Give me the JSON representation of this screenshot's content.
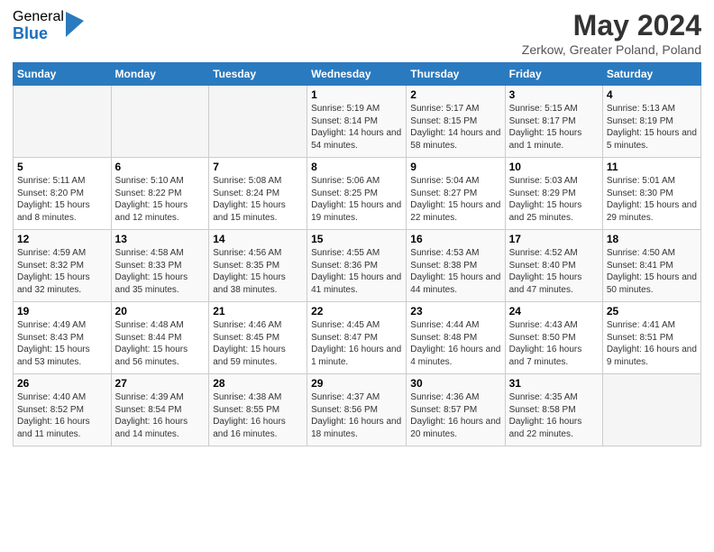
{
  "logo": {
    "general": "General",
    "blue": "Blue"
  },
  "title": "May 2024",
  "subtitle": "Zerkow, Greater Poland, Poland",
  "days_of_week": [
    "Sunday",
    "Monday",
    "Tuesday",
    "Wednesday",
    "Thursday",
    "Friday",
    "Saturday"
  ],
  "weeks": [
    [
      {
        "day": "",
        "info": ""
      },
      {
        "day": "",
        "info": ""
      },
      {
        "day": "",
        "info": ""
      },
      {
        "day": "1",
        "info": "Sunrise: 5:19 AM\nSunset: 8:14 PM\nDaylight: 14 hours and 54 minutes."
      },
      {
        "day": "2",
        "info": "Sunrise: 5:17 AM\nSunset: 8:15 PM\nDaylight: 14 hours and 58 minutes."
      },
      {
        "day": "3",
        "info": "Sunrise: 5:15 AM\nSunset: 8:17 PM\nDaylight: 15 hours and 1 minute."
      },
      {
        "day": "4",
        "info": "Sunrise: 5:13 AM\nSunset: 8:19 PM\nDaylight: 15 hours and 5 minutes."
      }
    ],
    [
      {
        "day": "5",
        "info": "Sunrise: 5:11 AM\nSunset: 8:20 PM\nDaylight: 15 hours and 8 minutes."
      },
      {
        "day": "6",
        "info": "Sunrise: 5:10 AM\nSunset: 8:22 PM\nDaylight: 15 hours and 12 minutes."
      },
      {
        "day": "7",
        "info": "Sunrise: 5:08 AM\nSunset: 8:24 PM\nDaylight: 15 hours and 15 minutes."
      },
      {
        "day": "8",
        "info": "Sunrise: 5:06 AM\nSunset: 8:25 PM\nDaylight: 15 hours and 19 minutes."
      },
      {
        "day": "9",
        "info": "Sunrise: 5:04 AM\nSunset: 8:27 PM\nDaylight: 15 hours and 22 minutes."
      },
      {
        "day": "10",
        "info": "Sunrise: 5:03 AM\nSunset: 8:29 PM\nDaylight: 15 hours and 25 minutes."
      },
      {
        "day": "11",
        "info": "Sunrise: 5:01 AM\nSunset: 8:30 PM\nDaylight: 15 hours and 29 minutes."
      }
    ],
    [
      {
        "day": "12",
        "info": "Sunrise: 4:59 AM\nSunset: 8:32 PM\nDaylight: 15 hours and 32 minutes."
      },
      {
        "day": "13",
        "info": "Sunrise: 4:58 AM\nSunset: 8:33 PM\nDaylight: 15 hours and 35 minutes."
      },
      {
        "day": "14",
        "info": "Sunrise: 4:56 AM\nSunset: 8:35 PM\nDaylight: 15 hours and 38 minutes."
      },
      {
        "day": "15",
        "info": "Sunrise: 4:55 AM\nSunset: 8:36 PM\nDaylight: 15 hours and 41 minutes."
      },
      {
        "day": "16",
        "info": "Sunrise: 4:53 AM\nSunset: 8:38 PM\nDaylight: 15 hours and 44 minutes."
      },
      {
        "day": "17",
        "info": "Sunrise: 4:52 AM\nSunset: 8:40 PM\nDaylight: 15 hours and 47 minutes."
      },
      {
        "day": "18",
        "info": "Sunrise: 4:50 AM\nSunset: 8:41 PM\nDaylight: 15 hours and 50 minutes."
      }
    ],
    [
      {
        "day": "19",
        "info": "Sunrise: 4:49 AM\nSunset: 8:43 PM\nDaylight: 15 hours and 53 minutes."
      },
      {
        "day": "20",
        "info": "Sunrise: 4:48 AM\nSunset: 8:44 PM\nDaylight: 15 hours and 56 minutes."
      },
      {
        "day": "21",
        "info": "Sunrise: 4:46 AM\nSunset: 8:45 PM\nDaylight: 15 hours and 59 minutes."
      },
      {
        "day": "22",
        "info": "Sunrise: 4:45 AM\nSunset: 8:47 PM\nDaylight: 16 hours and 1 minute."
      },
      {
        "day": "23",
        "info": "Sunrise: 4:44 AM\nSunset: 8:48 PM\nDaylight: 16 hours and 4 minutes."
      },
      {
        "day": "24",
        "info": "Sunrise: 4:43 AM\nSunset: 8:50 PM\nDaylight: 16 hours and 7 minutes."
      },
      {
        "day": "25",
        "info": "Sunrise: 4:41 AM\nSunset: 8:51 PM\nDaylight: 16 hours and 9 minutes."
      }
    ],
    [
      {
        "day": "26",
        "info": "Sunrise: 4:40 AM\nSunset: 8:52 PM\nDaylight: 16 hours and 11 minutes."
      },
      {
        "day": "27",
        "info": "Sunrise: 4:39 AM\nSunset: 8:54 PM\nDaylight: 16 hours and 14 minutes."
      },
      {
        "day": "28",
        "info": "Sunrise: 4:38 AM\nSunset: 8:55 PM\nDaylight: 16 hours and 16 minutes."
      },
      {
        "day": "29",
        "info": "Sunrise: 4:37 AM\nSunset: 8:56 PM\nDaylight: 16 hours and 18 minutes."
      },
      {
        "day": "30",
        "info": "Sunrise: 4:36 AM\nSunset: 8:57 PM\nDaylight: 16 hours and 20 minutes."
      },
      {
        "day": "31",
        "info": "Sunrise: 4:35 AM\nSunset: 8:58 PM\nDaylight: 16 hours and 22 minutes."
      },
      {
        "day": "",
        "info": ""
      }
    ]
  ]
}
